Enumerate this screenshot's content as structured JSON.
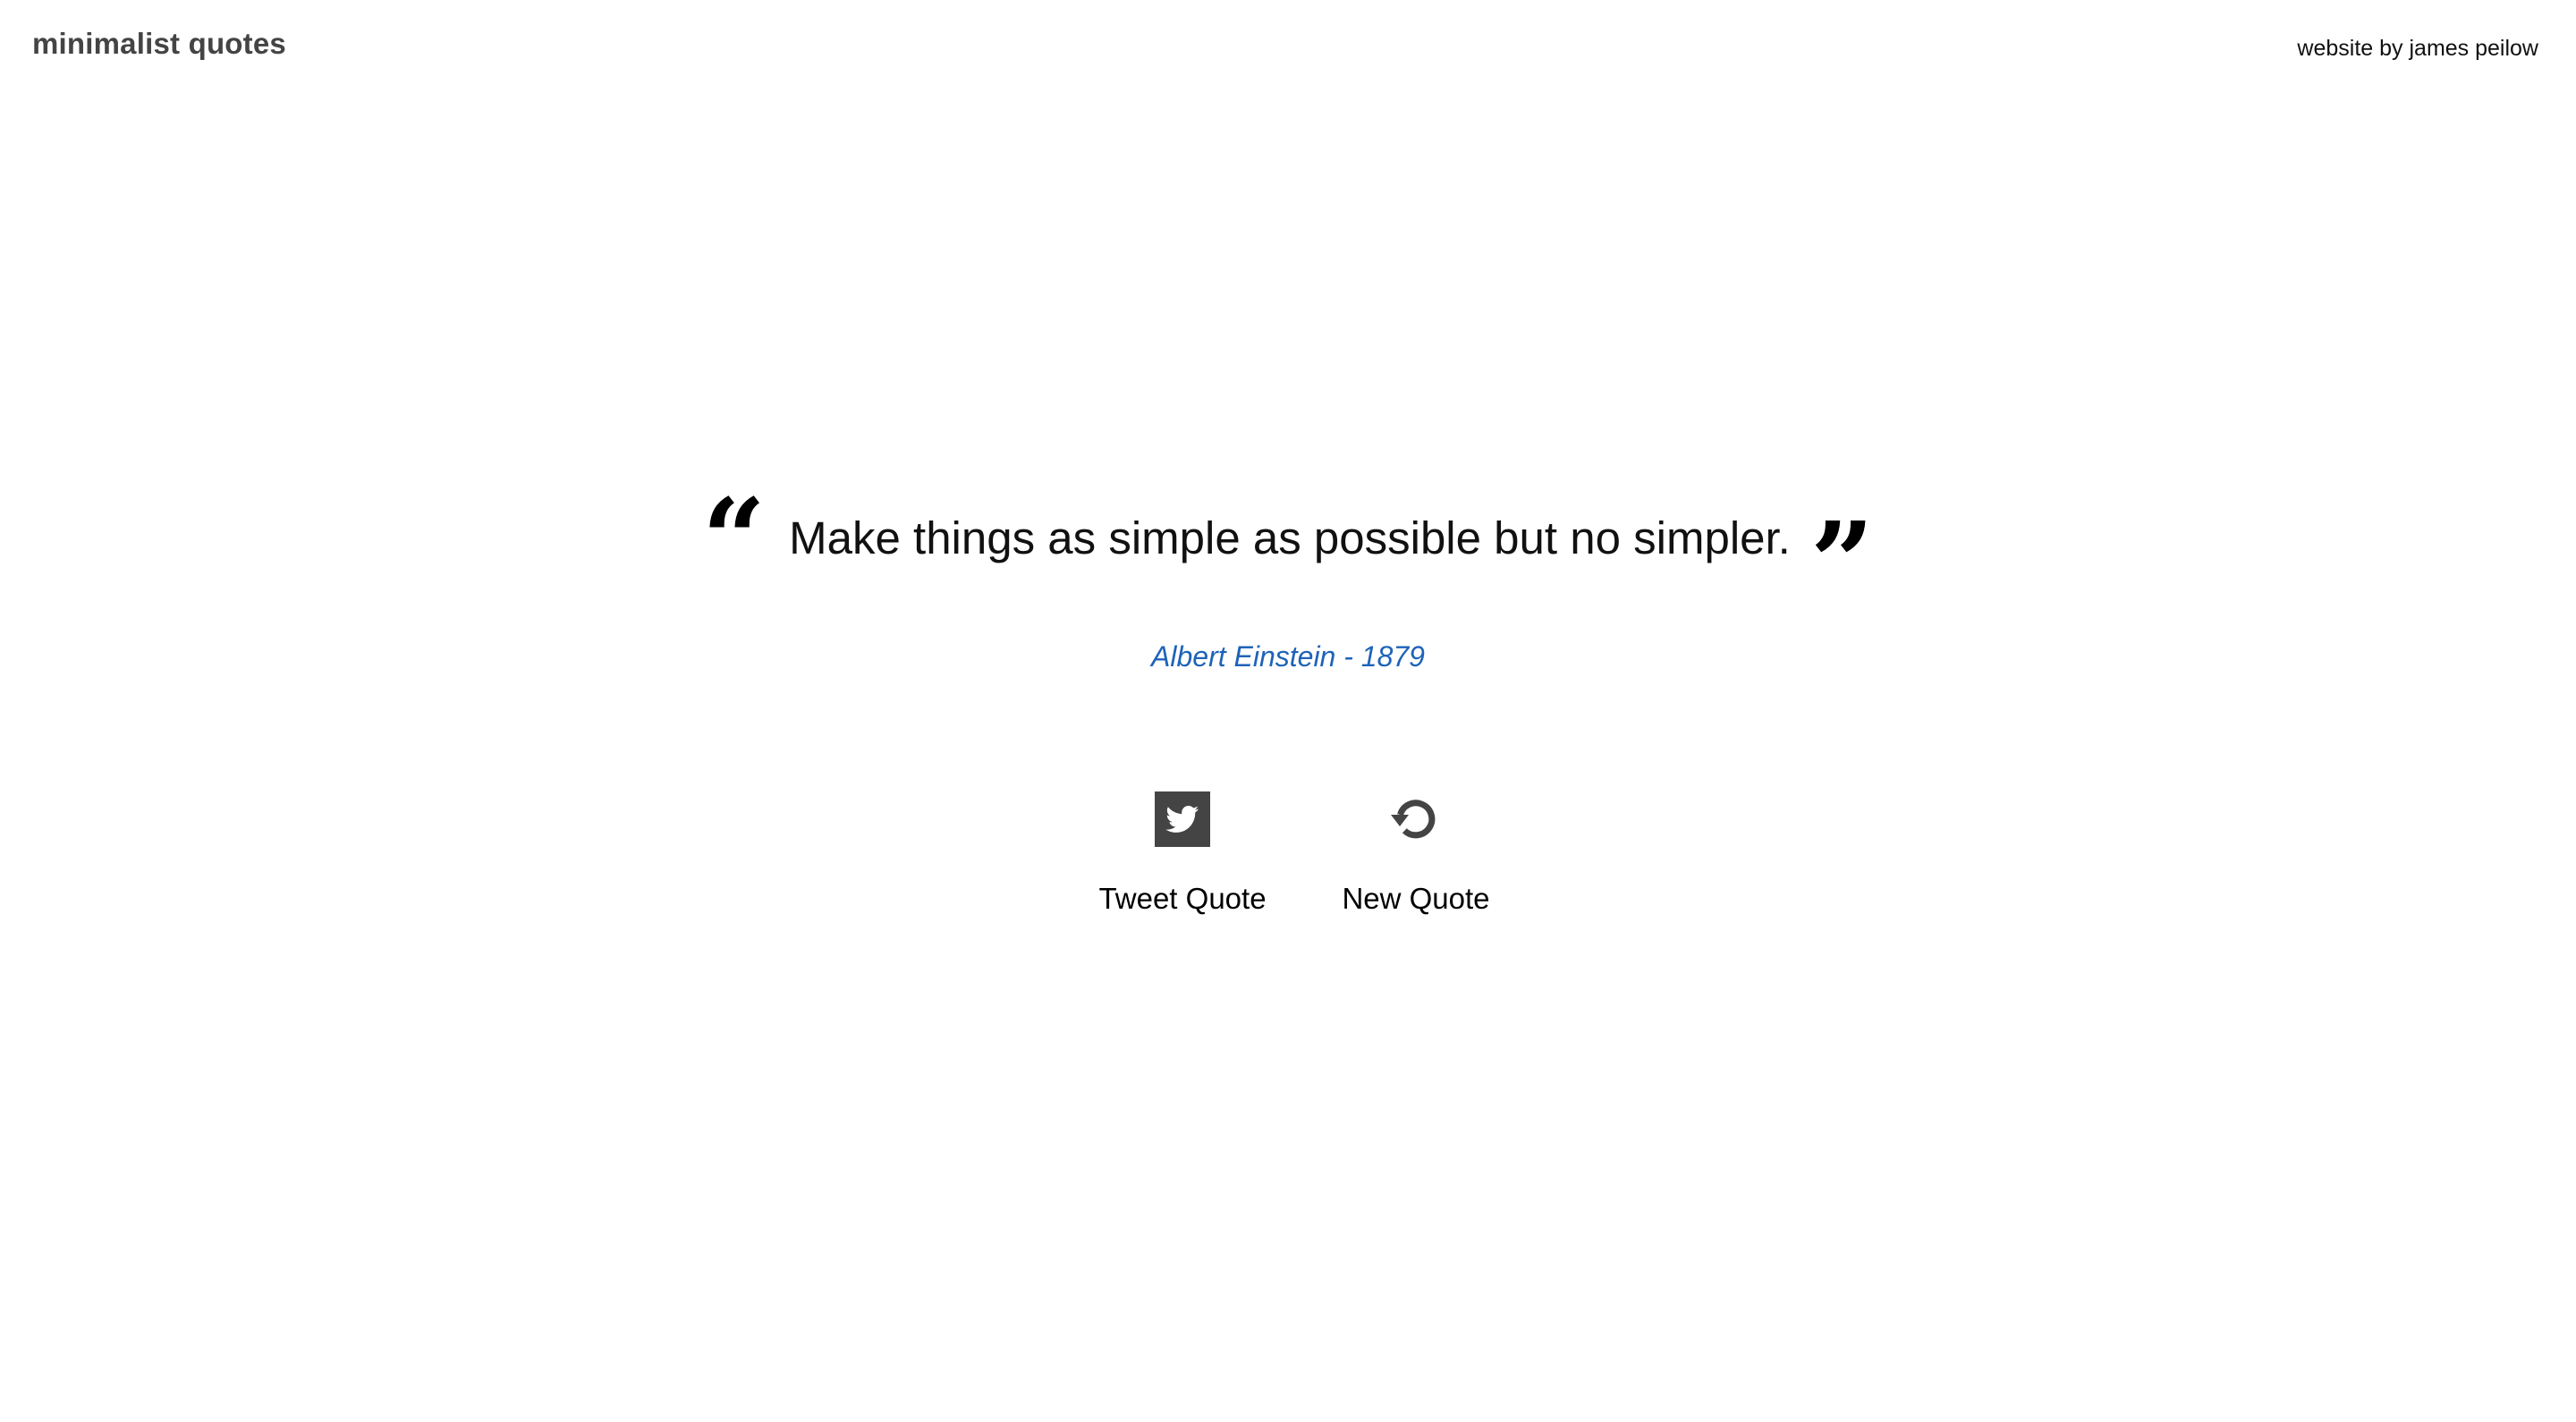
{
  "header": {
    "site_title": "minimalist quotes",
    "credit": "website by james peilow"
  },
  "quote": {
    "open_mark": "“",
    "text": "Make things as simple as possible but no simpler.",
    "close_mark": "”",
    "author_line": "Albert Einstein - 1879"
  },
  "actions": {
    "tweet": {
      "label": "Tweet Quote",
      "icon": "twitter-icon"
    },
    "new": {
      "label": "New Quote",
      "icon": "refresh-icon"
    }
  },
  "colors": {
    "title": "#444444",
    "author": "#1e63b8",
    "icon": "#444444",
    "background": "#ffffff"
  }
}
